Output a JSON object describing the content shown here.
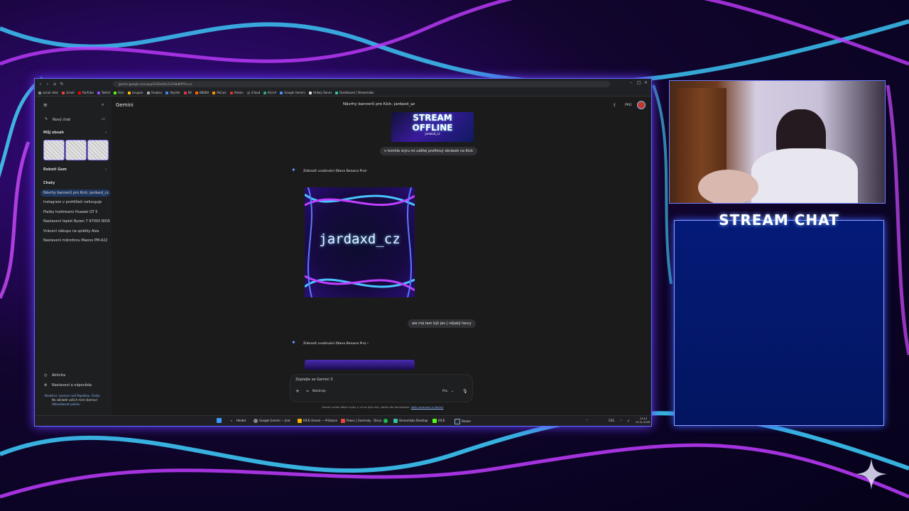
{
  "browser": {
    "url": "gemini.google.com/app/0326e64c2125db8f9?hl=cs",
    "bookmarks": [
      "social sites",
      "Gmail",
      "YouTube",
      "Twitch",
      "Kick",
      "Linupon",
      "Greptus",
      "Skylink",
      "EB",
      "ENEBA",
      "PoCasi",
      "Alzken",
      "iCloud",
      "KicicA",
      "Google Gemini",
      "Hrdaly Šanns",
      "Dashboard / Streamlabs"
    ]
  },
  "sidebar": {
    "new_chat": "Nový chat",
    "my_content": "Můj obsah",
    "gems": "Roboti Gem",
    "chats_heading": "Chaty",
    "chats": [
      "Návrhy bannerů pro Kick: jardaxd_cz",
      "Instagram v prohlížeči nefunguje",
      "Platby hodinkami Huawei GT 5",
      "Nastavení teplot Ryzen 7 9700X BIOS",
      "Vrácení nákupu na splátky Alza",
      "Nastavení mikrofonu Maono PM-422"
    ],
    "activity": "Aktivita",
    "settings": "Nastavení a nápověda",
    "location_line1": "Brodzice: Loonice nad Popelkou, Česko",
    "location_line2": "Na základě vašich míst (domov)",
    "location_line3": "Aktualizovat polohu"
  },
  "header": {
    "logo": "Gemini",
    "conversation_title": "Návrhy bannerů pro Kick: jardaxd_cz",
    "plan_badge": "PRO"
  },
  "conversation": {
    "offline_line1": "STREAM",
    "offline_line2": "OFFLINE",
    "offline_sub": "jardaxd_cz",
    "user_msg_1": "v tomhle stylu mi udělej profilový obrázek na Kick",
    "reasoning_1": "Zobrazit uvažování (Nano Banana Pro)",
    "image_text": "jardaxd_cz",
    "user_msg_2": "ale má tam být jen J nějaký fancy",
    "reasoning_2": "Zobrazit uvažování (Nano Banana Pro)"
  },
  "input": {
    "placeholder": "Zeptejte se Gemini 3",
    "tools": "Nástroje",
    "mode": "Pro",
    "disclaimer": "Gemini může dělat chyby (i co se týče lidí), takže vše kontrolujte.",
    "disclaimer_link": "Vaše soukromí a Gemini"
  },
  "taskbar": {
    "search": "Hledat",
    "apps": [
      "Google Gemini — Jiné",
      "KICK stream — Průzkum",
      "Pobec | Gamesky - Disco",
      "Streamlabs Desktop",
      "KICK",
      "Steam"
    ],
    "language": "CES",
    "time": "13:13",
    "date": "25.01.2026"
  },
  "overlay": {
    "chat_title": "STREAM CHAT"
  },
  "colors": {
    "accent_blue": "#1f3760",
    "chat_bg": "#041a78",
    "gemini_star": "#6ea3ff"
  }
}
